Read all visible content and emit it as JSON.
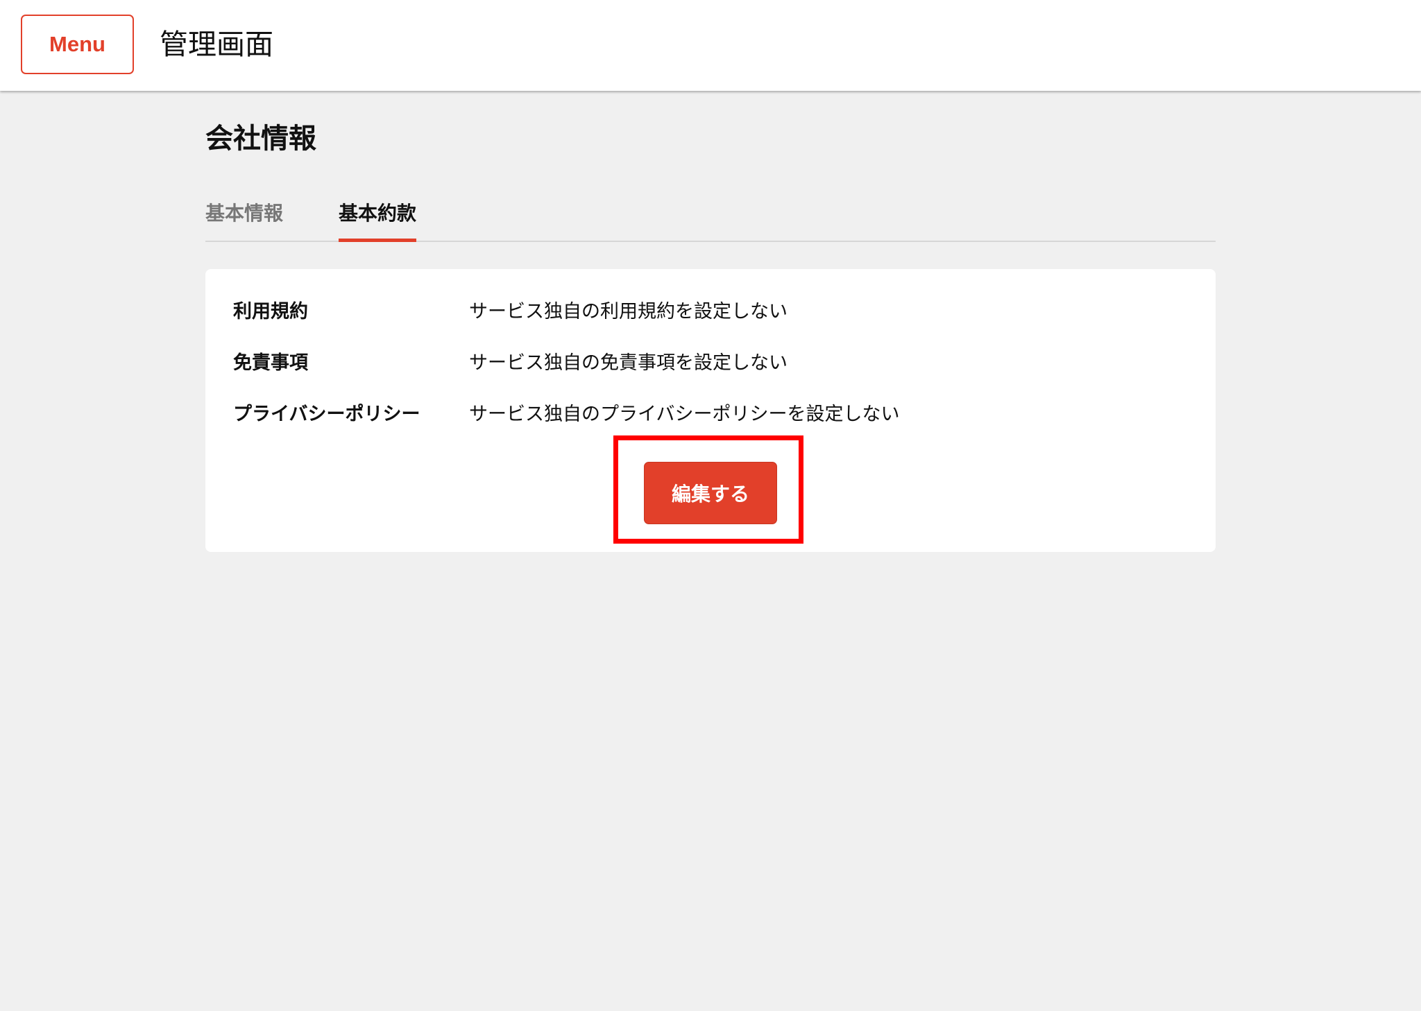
{
  "header": {
    "menu_label": "Menu",
    "app_title": "管理画面"
  },
  "page": {
    "title": "会社情報"
  },
  "tabs": [
    {
      "label": "基本情報",
      "active": false
    },
    {
      "label": "基本約款",
      "active": true
    }
  ],
  "terms": [
    {
      "label": "利用規約",
      "value": "サービス独自の利用規約を設定しない"
    },
    {
      "label": "免責事項",
      "value": "サービス独自の免責事項を設定しない"
    },
    {
      "label": "プライバシーポリシー",
      "value": "サービス独自のプライバシーポリシーを設定しない"
    }
  ],
  "actions": {
    "edit_label": "編集する"
  },
  "colors": {
    "accent": "#e2402a",
    "highlight": "#ff0000",
    "background": "#f0f0f0"
  }
}
